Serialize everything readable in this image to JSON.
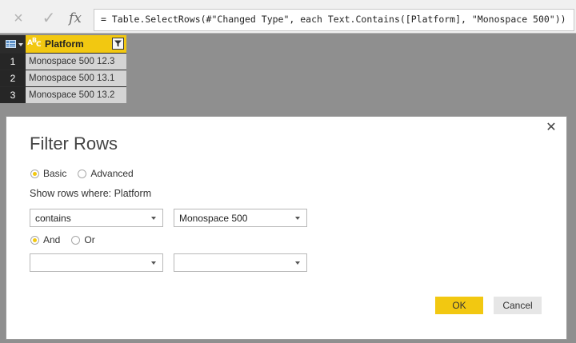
{
  "formula_bar": {
    "cancel_icon": "×",
    "commit_icon": "✓",
    "fx_label": "fx",
    "formula": "= Table.SelectRows(#\"Changed Type\", each Text.Contains([Platform], \"Monospace 500\"))"
  },
  "grid": {
    "column_type_icon": "ABC",
    "column_header": "Platform",
    "rows": [
      {
        "num": "1",
        "value": "Monospace 500 12.3"
      },
      {
        "num": "2",
        "value": "Monospace 500 13.1"
      },
      {
        "num": "3",
        "value": "Monospace 500 13.2"
      }
    ]
  },
  "dialog": {
    "title": "Filter Rows",
    "close_icon": "✕",
    "mode_options": [
      {
        "label": "Basic",
        "checked": true
      },
      {
        "label": "Advanced",
        "checked": false
      }
    ],
    "show_rows_label": "Show rows where: Platform",
    "condition1": {
      "operator": "contains",
      "value": "Monospace 500"
    },
    "logic_options": [
      {
        "label": "And",
        "checked": true
      },
      {
        "label": "Or",
        "checked": false
      }
    ],
    "condition2": {
      "operator": "",
      "value": ""
    },
    "ok_label": "OK",
    "cancel_label": "Cancel"
  },
  "colors": {
    "accent": "#f2c811",
    "grid_header_bg": "#2b2b2b",
    "cell_bg": "#d4d4d4",
    "overlay_bg": "#8f8f8f"
  }
}
